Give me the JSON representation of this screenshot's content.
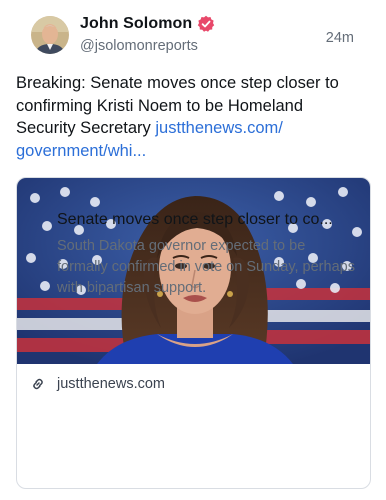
{
  "author": {
    "display_name": "John Solomon",
    "handle": "@jsolomonreports",
    "verified_icon": "verified-badge-icon",
    "verified_color": "#e8486a"
  },
  "post": {
    "timestamp": "24m",
    "text": "Breaking: Senate moves once step closer to confirming Kristi Noem to be Homeland Security Secretary ",
    "link_text": "justthenews.com/\ngovernment/whi...",
    "link_color": "#2c6fd8"
  },
  "link_card": {
    "domain": "justthenews.com",
    "title": "Senate moves once step closer to co...",
    "description": "South Dakota governor expected to be formally confirmed in vote on Sunday, perhaps with bipartisan support.",
    "link_icon": "link-icon"
  }
}
